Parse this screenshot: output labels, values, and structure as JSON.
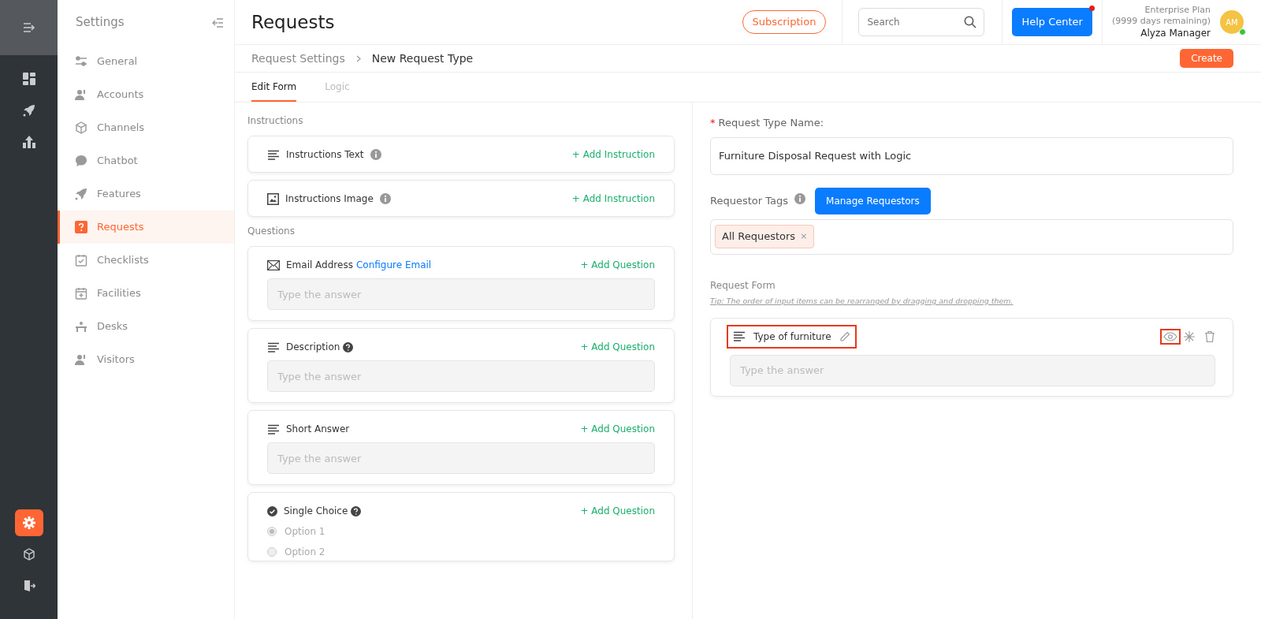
{
  "rail": [
    {
      "kind": "menu",
      "selected": false
    },
    {
      "kind": "dashboard",
      "selected": false
    },
    {
      "kind": "rocket",
      "selected": false
    },
    {
      "kind": "chart",
      "selected": false
    },
    {
      "kind": "gear",
      "selected": true
    },
    {
      "kind": "cube",
      "selected": false
    },
    {
      "kind": "exit",
      "selected": false
    }
  ],
  "sidebar": {
    "title": "Settings",
    "items": [
      {
        "label": "General",
        "kind": "sliders",
        "selected": false
      },
      {
        "label": "Accounts",
        "kind": "users",
        "selected": false
      },
      {
        "label": "Channels",
        "kind": "cube",
        "selected": false
      },
      {
        "label": "Chatbot",
        "kind": "chat",
        "selected": false
      },
      {
        "label": "Features",
        "kind": "rocket",
        "selected": false
      },
      {
        "label": "Requests",
        "kind": "question",
        "selected": true
      },
      {
        "label": "Checklists",
        "kind": "clipboard",
        "selected": false
      },
      {
        "label": "Facilities",
        "kind": "calendar",
        "selected": false
      },
      {
        "label": "Desks",
        "kind": "desk",
        "selected": false
      },
      {
        "label": "Visitors",
        "kind": "users",
        "selected": false
      }
    ]
  },
  "header": {
    "title": "Requests",
    "subscription": "Subscription",
    "search_placeholder": "Search",
    "help": "Help Center",
    "help_notification": true,
    "plan": "Enterprise Plan",
    "days": "(9999 days remaining)",
    "user": "Alyza Manager",
    "avatar": "AM",
    "online": true
  },
  "breadcrumb": [
    "Request Settings",
    "New Request Type"
  ],
  "create": "Create",
  "tabs": [
    {
      "label": "Edit Form",
      "selected": true
    },
    {
      "label": "Logic",
      "selected": false
    }
  ],
  "instructions_label": "Instructions",
  "instructions": [
    {
      "kind": "text",
      "label": "Instructions Text",
      "action": "+ Add Instruction"
    },
    {
      "kind": "image",
      "label": "Instructions Image",
      "action": "+ Add Instruction"
    }
  ],
  "questions_label": "Questions",
  "questions": [
    {
      "kind": "email",
      "label": "Email Address",
      "link": "Configure Email",
      "action": "+ Add Question",
      "placeholder": "Type the answer"
    },
    {
      "kind": "description",
      "label": "Description",
      "action": "+ Add Question",
      "placeholder": "Type the answer"
    },
    {
      "kind": "short",
      "label": "Short Answer",
      "action": "+ Add Question",
      "placeholder": "Type the answer"
    },
    {
      "kind": "single",
      "label": "Single Choice",
      "action": "+ Add Question",
      "options": [
        {
          "label": "Option 1",
          "selected": true
        },
        {
          "label": "Option 2",
          "selected": false
        }
      ]
    }
  ],
  "request_type_name": {
    "label": "Request Type Name:",
    "required_mark": "*",
    "value": "Furniture Disposal Request with Logic"
  },
  "requestor_tags": {
    "label": "Requestor Tags",
    "button": "Manage Requestors",
    "tags": [
      {
        "label": "All Requestors",
        "remove": "×"
      }
    ]
  },
  "request_form": {
    "label": "Request Form",
    "tip": "Tip: The order of input items can be rearranged by dragging and dropping them.",
    "items": [
      {
        "label": "Type of furniture",
        "placeholder": "Type the answer",
        "title_highlighted": true,
        "eye_highlighted": true
      }
    ]
  }
}
